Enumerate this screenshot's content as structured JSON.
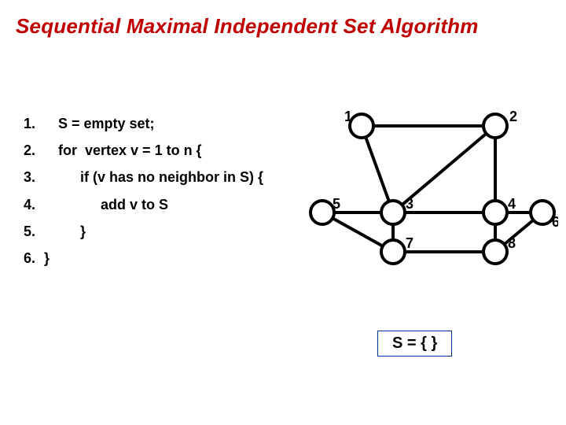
{
  "title": "Sequential Maximal Independent Set Algorithm",
  "code": {
    "l1_num": "1.",
    "l1": "S = empty set;",
    "l2_num": "2.",
    "l2": "for  vertex v = 1 to n {",
    "l3_num": "3.",
    "l3": "if (v has no neighbor in S) {",
    "l4_num": "4.",
    "l4": "add v to S",
    "l5_num": "5.",
    "l5": "}",
    "l6_num": "6.",
    "l6": "}"
  },
  "graph": {
    "labels": {
      "n1": "1",
      "n2": "2",
      "n3": "3",
      "n4": "4",
      "n5": "5",
      "n6": "6",
      "n7": "7",
      "n8": "8"
    }
  },
  "result": "S = { }"
}
